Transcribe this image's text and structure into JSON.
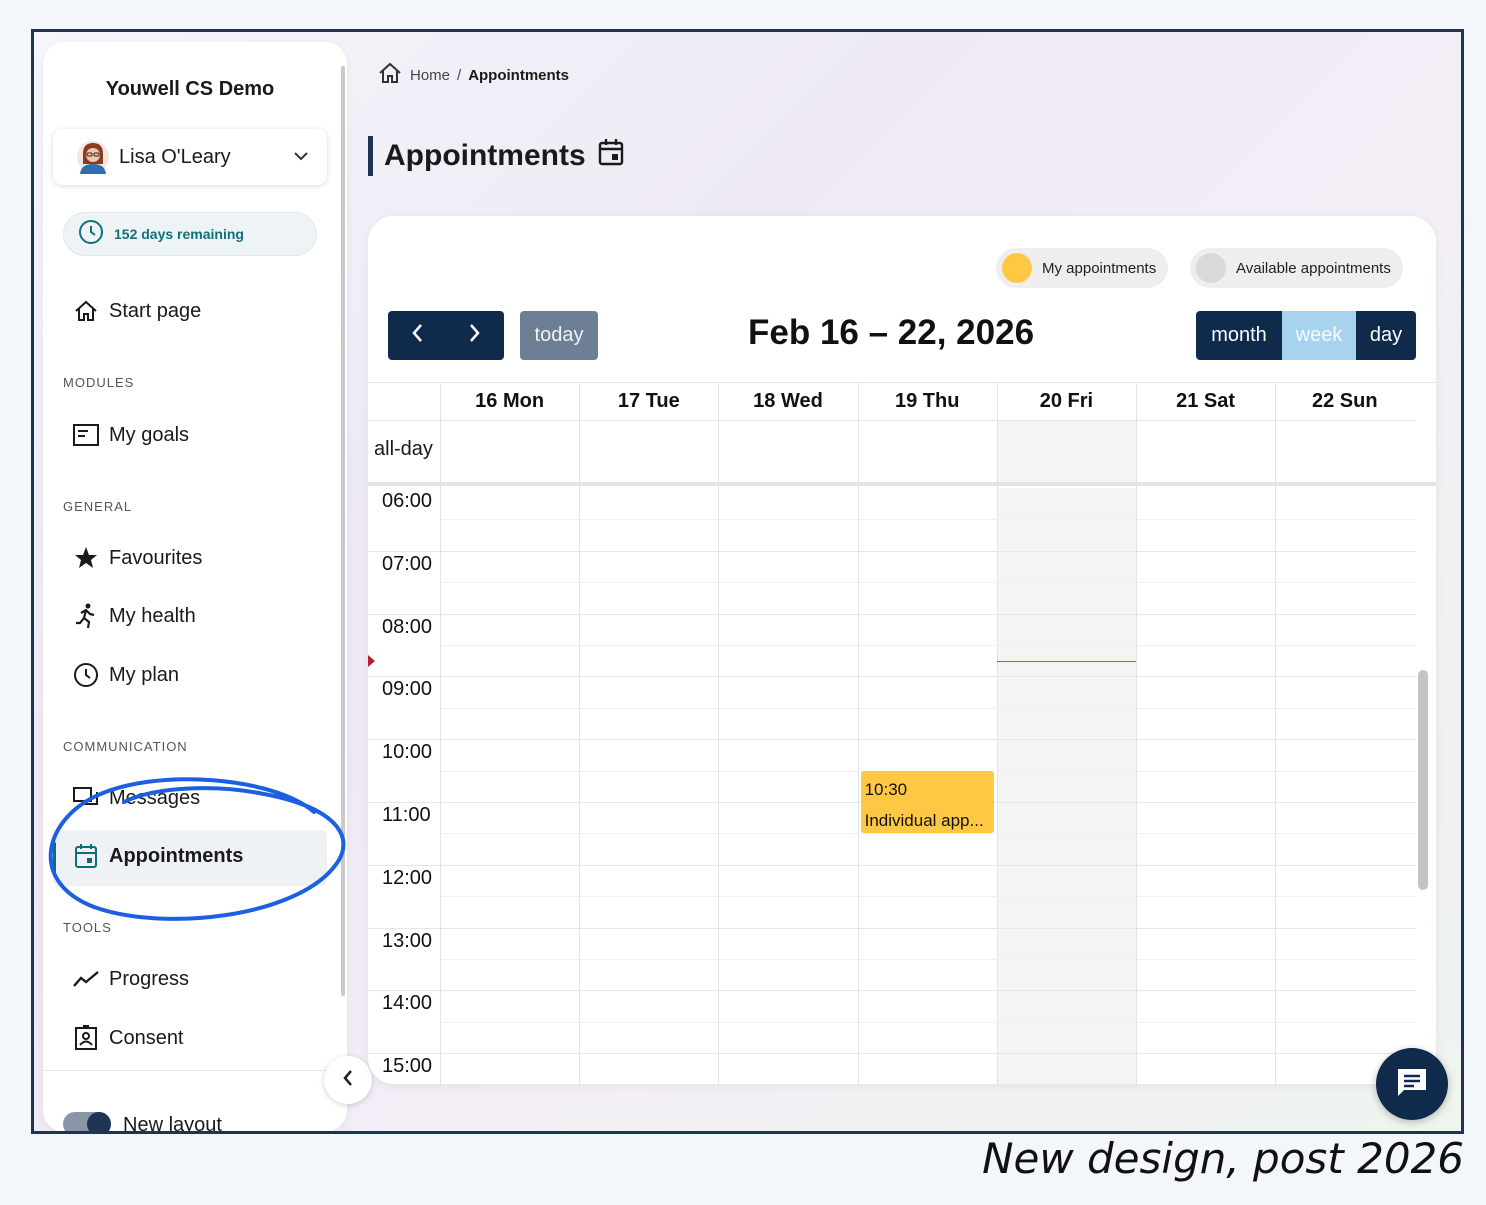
{
  "sidebar": {
    "org_name": "Youwell CS Demo",
    "user_name": "Lisa O'Leary",
    "days_remaining": "152 days remaining",
    "start_page": "Start page",
    "sections": {
      "modules": "MODULES",
      "general": "GENERAL",
      "communication": "COMMUNICATION",
      "tools": "TOOLS"
    },
    "items": {
      "my_goals": "My goals",
      "favourites": "Favourites",
      "my_health": "My health",
      "my_plan": "My plan",
      "messages": "Messages",
      "appointments": "Appointments",
      "progress": "Progress",
      "consent": "Consent"
    },
    "new_layout": "New layout"
  },
  "breadcrumb": {
    "home": "Home",
    "separator": "/",
    "current": "Appointments"
  },
  "page_title": "Appointments",
  "legend": {
    "mine": "My appointments",
    "available": "Available appointments"
  },
  "toolbar": {
    "today": "today",
    "range": "Feb 16 – 22, 2026",
    "views": {
      "month": "month",
      "week": "week",
      "day": "day"
    },
    "active_view": "week"
  },
  "calendar": {
    "days": [
      "16 Mon",
      "17 Tue",
      "18 Wed",
      "19 Thu",
      "20 Fri",
      "21 Sat",
      "22 Sun"
    ],
    "allday_label": "all-day",
    "hours": [
      "06:00",
      "07:00",
      "08:00",
      "09:00",
      "10:00",
      "11:00",
      "12:00",
      "13:00",
      "14:00",
      "15:00"
    ],
    "highlighted_day": "20 Fri",
    "now_time": "08:45",
    "events": [
      {
        "day": "19 Thu",
        "start": "10:30",
        "end": "11:30",
        "time_label": "10:30",
        "title": "Individual app..."
      }
    ]
  },
  "caption": "New design, post 2026",
  "colors": {
    "navy": "#0f2a4a",
    "teal": "#0d6e7a",
    "my_appointment": "#ffc844",
    "available": "#d9d9d9",
    "active_view": "#a7d3ee"
  }
}
